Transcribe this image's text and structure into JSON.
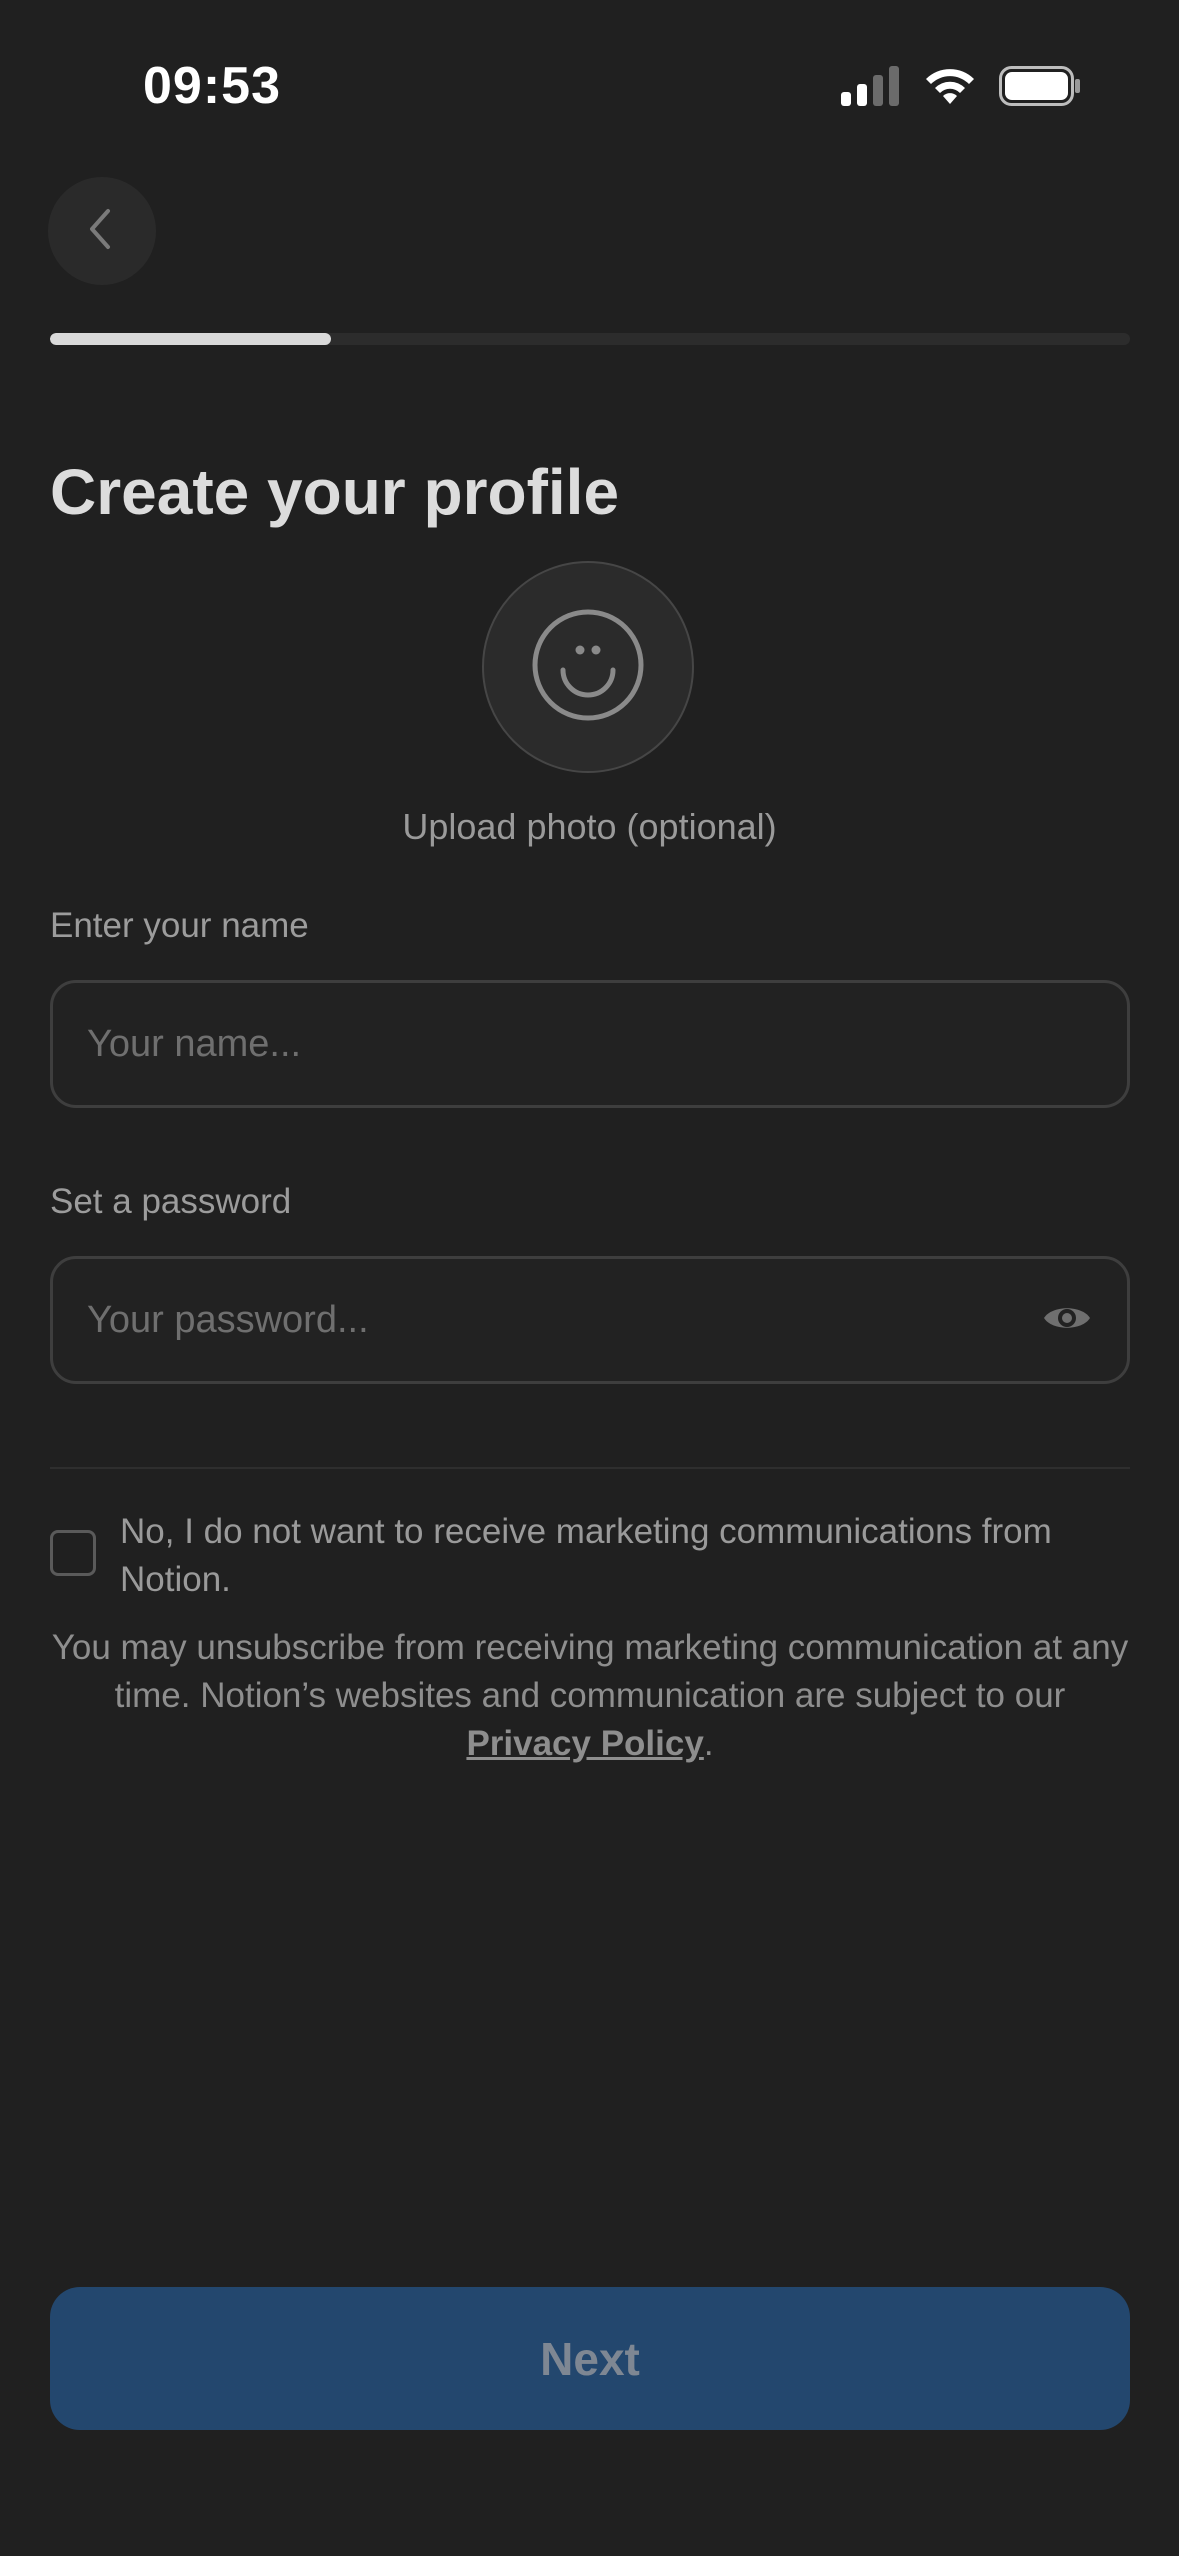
{
  "status_bar": {
    "time": "09:53",
    "icons": [
      "signal-icon",
      "wifi-icon",
      "battery-icon"
    ]
  },
  "nav": {
    "back_icon": "chevron-left-icon"
  },
  "progress": {
    "fraction": 0.26
  },
  "header": {
    "title": "Create your profile"
  },
  "avatar": {
    "icon": "smiley-face-icon",
    "upload_label": "Upload photo (optional)"
  },
  "form": {
    "name": {
      "label": "Enter your name",
      "placeholder": "Your name...",
      "value": ""
    },
    "password": {
      "label": "Set a password",
      "placeholder": "Your password...",
      "value": "",
      "toggle_icon": "eye-icon"
    }
  },
  "consent": {
    "checked": false,
    "text": "No, I do not want to receive marketing communications from Notion."
  },
  "legal": {
    "text_before": "You may unsubscribe from receiving marketing communication at any time. Notion’s websites and communication are subject to our ",
    "link": "Privacy Policy",
    "text_after": "."
  },
  "actions": {
    "next_label": "Next"
  },
  "colors": {
    "background": "#202020",
    "primary_button": "#23476e",
    "progress_fill": "#d9d9d9"
  }
}
